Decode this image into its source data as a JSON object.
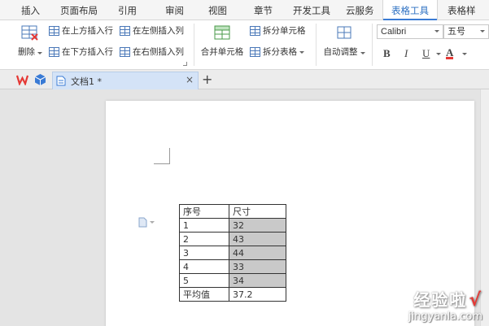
{
  "menu": {
    "items": [
      "插入",
      "页面布局",
      "引用",
      "审阅",
      "视图",
      "章节",
      "开发工具",
      "云服务",
      "表格工具",
      "表格样"
    ],
    "active_index": 8
  },
  "ribbon": {
    "delete_label": "删除",
    "insert_above": "在上方插入行",
    "insert_below": "在下方插入行",
    "insert_left": "在左侧插入列",
    "insert_right": "在右侧插入列",
    "merge_cells": "合并单元格",
    "split_cells": "拆分单元格",
    "split_table": "拆分表格",
    "auto_fit": "自动调整",
    "font_name": "Calibri",
    "font_size": "五号",
    "bold": "B",
    "italic": "I",
    "underline": "U",
    "font_color": "A"
  },
  "tabs": {
    "doc_title": "文档1 *",
    "close": "×",
    "new_tab": "+"
  },
  "table": {
    "header": [
      "序号",
      "尺寸"
    ],
    "rows": [
      [
        "1",
        "32"
      ],
      [
        "2",
        "43"
      ],
      [
        "3",
        "44"
      ],
      [
        "4",
        "33"
      ],
      [
        "5",
        "34"
      ]
    ],
    "footer": [
      "平均值",
      "37.2"
    ]
  },
  "watermark": {
    "title": "经验啦",
    "check": "√",
    "url": "jingyanla.com"
  },
  "colors": {
    "accent": "#2b6fc2",
    "shade": "#c9c9c9",
    "wps_red": "#e53935"
  }
}
